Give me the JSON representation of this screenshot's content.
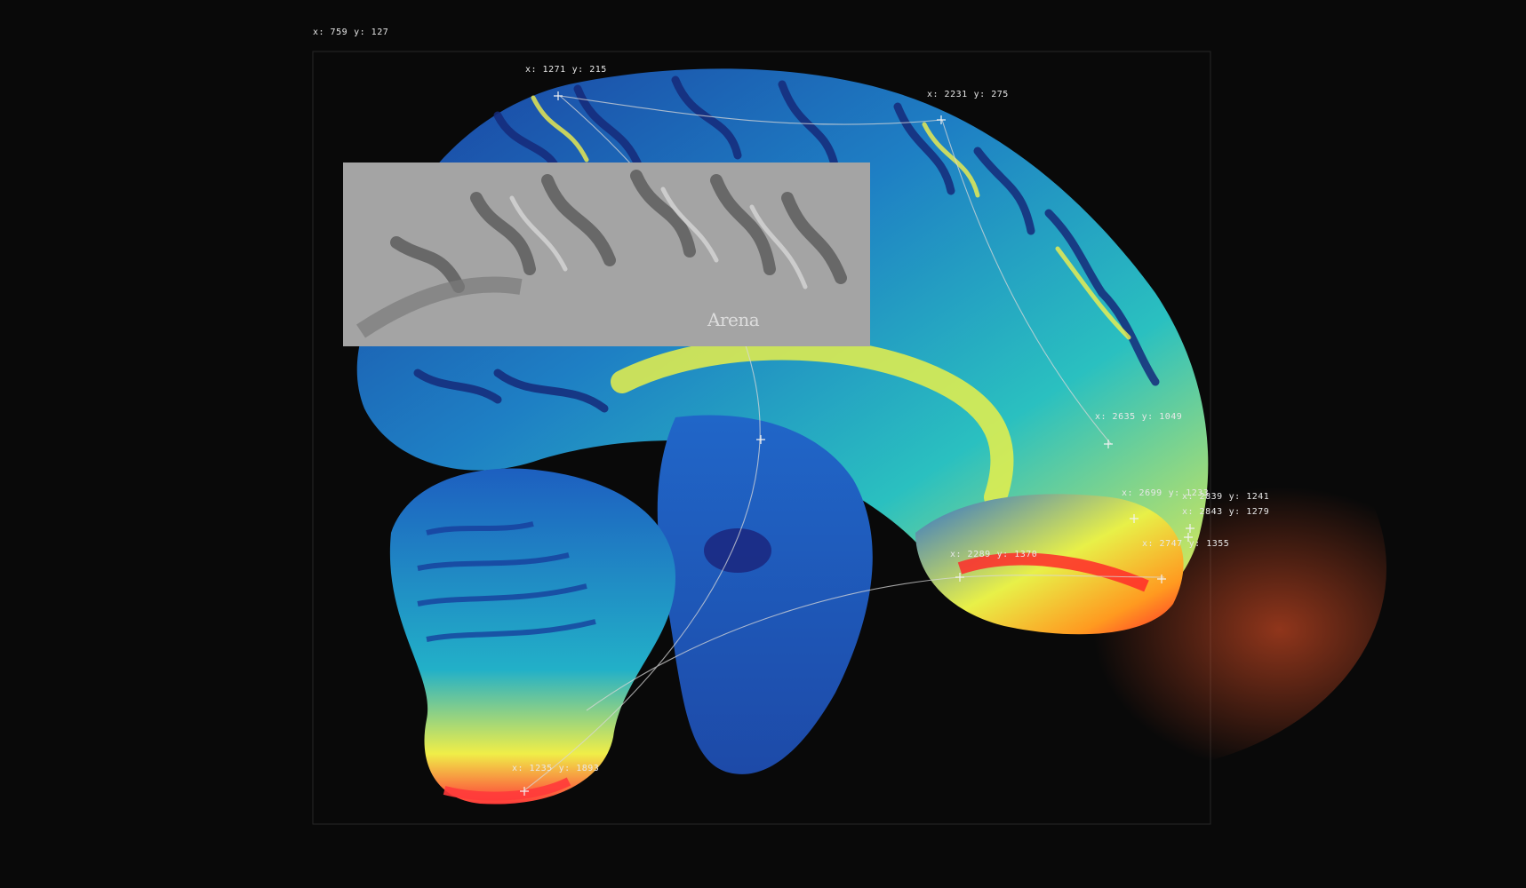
{
  "wordmark": "Arena",
  "coordinates": [
    {
      "x_label": "x: 759",
      "y_label": "y: 127"
    },
    {
      "x_label": "x: 1271",
      "y_label": "y: 215"
    },
    {
      "x_label": "x: 2231",
      "y_label": "y: 275"
    },
    {
      "x_label": "x: 2635",
      "y_label": "y: 1049"
    },
    {
      "x_label": "x: 2699",
      "y_label": "y: 1233"
    },
    {
      "x_label": "x: 2839",
      "y_label": "y: 1241"
    },
    {
      "x_label": "x: 2843",
      "y_label": "y: 1279"
    },
    {
      "x_label": "x: 2747",
      "y_label": "y: 1355"
    },
    {
      "x_label": "x: 2289",
      "y_label": "y: 1370"
    },
    {
      "x_label": "x: 1235",
      "y_label": "y: 1893"
    }
  ],
  "colors": {
    "background": "#090909",
    "frame": "#2a2a2a",
    "deep_blue": "#1b2f8a",
    "cyan": "#1fb8c8",
    "teal": "#2fd2b0",
    "yellow": "#f4f04a",
    "orange": "#ff7a1e",
    "red": "#ff2a2a",
    "grey_panel": "#a3a3a3"
  }
}
